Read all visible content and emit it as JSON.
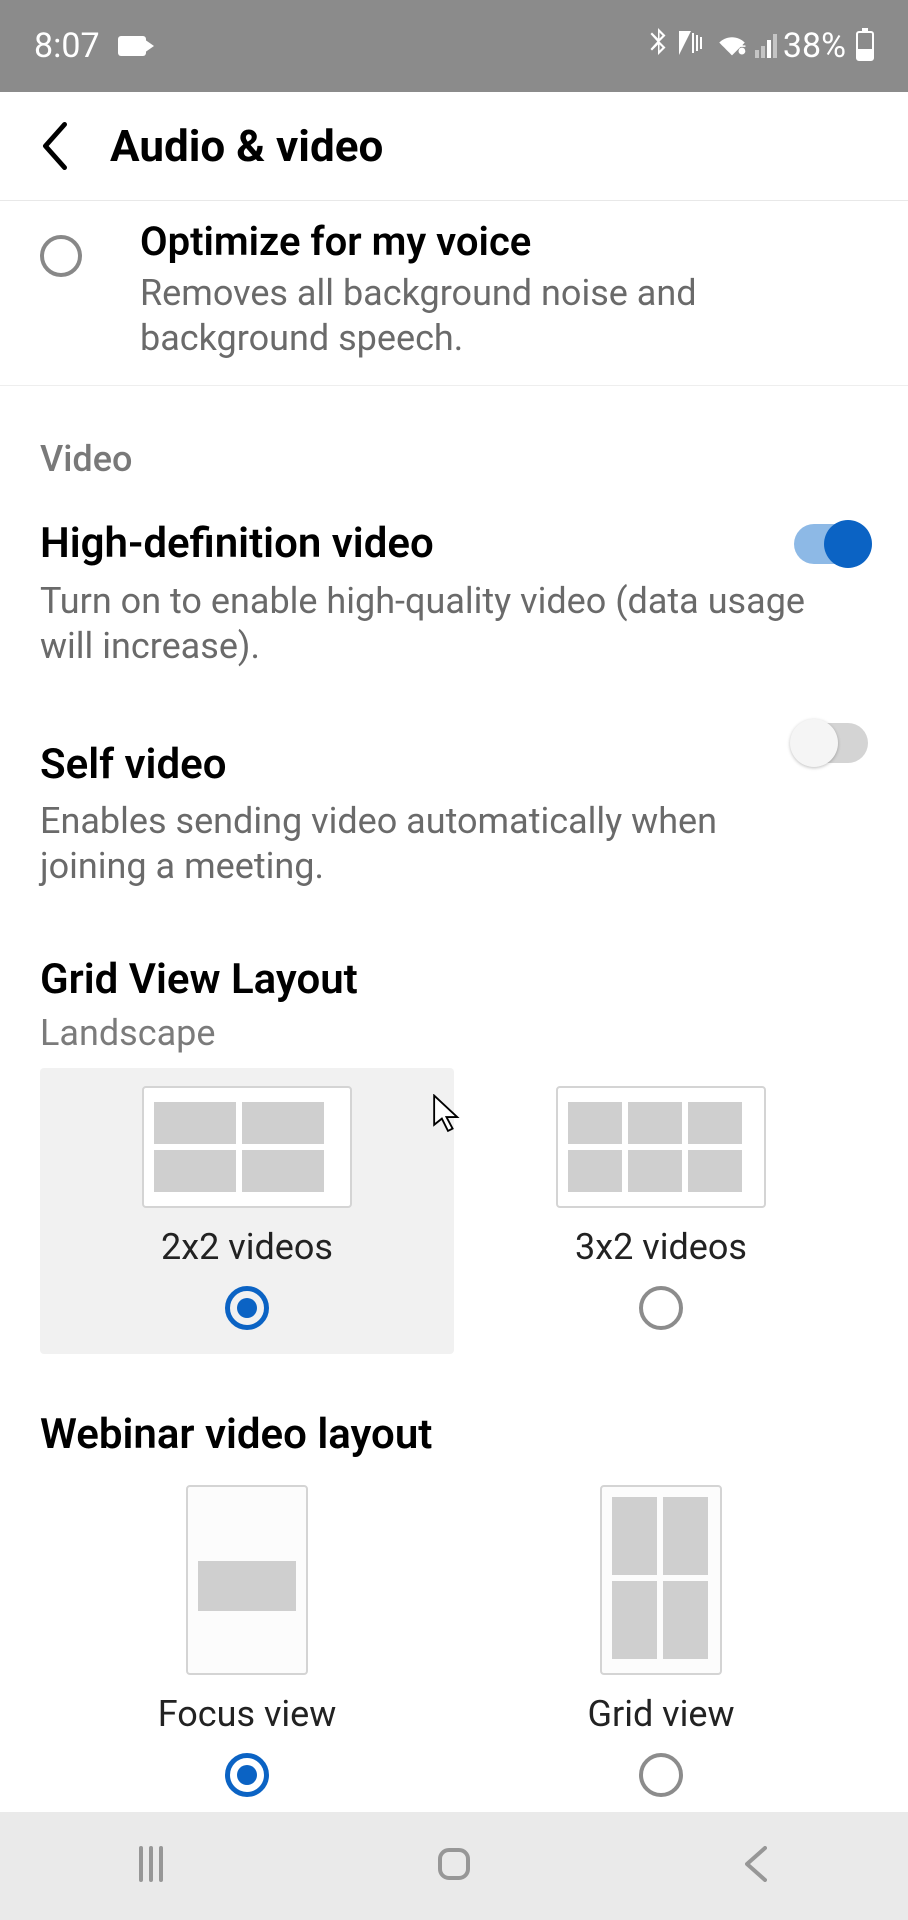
{
  "status_bar": {
    "time": "8:07",
    "battery_percent": "38%"
  },
  "header": {
    "title": "Audio & video"
  },
  "audio_option": {
    "title": "Optimize for my voice",
    "description": "Removes all background noise and background speech."
  },
  "video_section": {
    "label": "Video"
  },
  "hd_video": {
    "title": "High-definition video",
    "description": "Turn on to enable high-quality video (data usage will increase).",
    "enabled": true
  },
  "self_video": {
    "title": "Self video",
    "description": "Enables sending video automatically when joining a meeting.",
    "enabled": false
  },
  "grid_view": {
    "title": "Grid View Layout",
    "mode_label": "Landscape",
    "options": [
      {
        "label": "2x2 videos",
        "selected": true
      },
      {
        "label": "3x2 videos",
        "selected": false
      }
    ]
  },
  "webinar_layout": {
    "title": "Webinar video layout",
    "options": [
      {
        "label": "Focus view",
        "selected": true
      },
      {
        "label": "Grid view",
        "selected": false
      }
    ]
  }
}
